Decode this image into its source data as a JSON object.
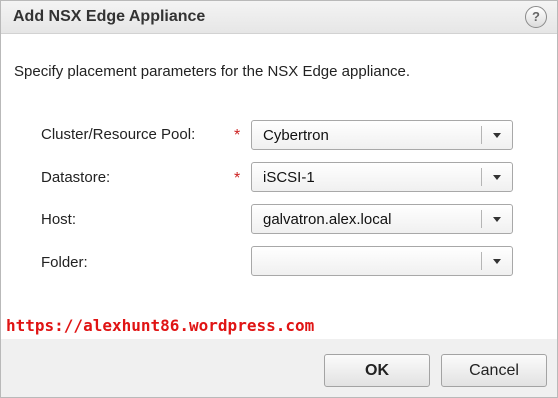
{
  "dialog": {
    "title": "Add NSX Edge Appliance",
    "help_label": "?",
    "instruction": "Specify placement parameters for the NSX Edge appliance."
  },
  "fields": [
    {
      "label": "Cluster/Resource Pool:",
      "required": true,
      "value": "Cybertron"
    },
    {
      "label": "Datastore:",
      "required": true,
      "value": "iSCSI-1"
    },
    {
      "label": "Host:",
      "required": false,
      "value": "galvatron.alex.local"
    },
    {
      "label": "Folder:",
      "required": false,
      "value": ""
    }
  ],
  "required_marker": "*",
  "watermark": "https://alexhunt86.wordpress.com",
  "buttons": {
    "ok": "OK",
    "cancel": "Cancel"
  },
  "colors": {
    "required": "#cc2222",
    "watermark": "#e01414"
  },
  "icons": {
    "help": "help-icon",
    "dropdown": "chevron-down-icon"
  }
}
